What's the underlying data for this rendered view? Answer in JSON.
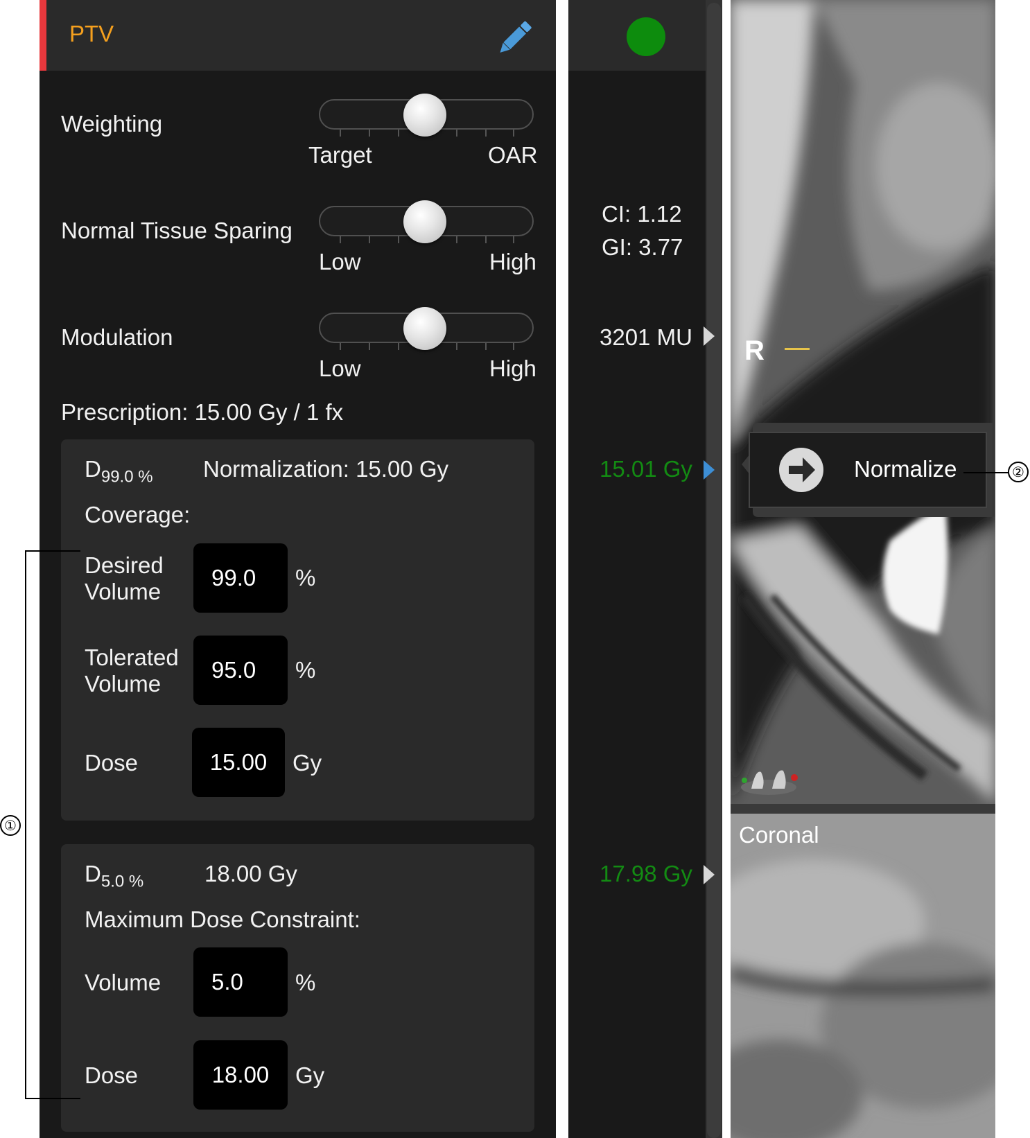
{
  "header": {
    "structure_name": "PTV",
    "edit_icon": "pencil-icon"
  },
  "sliders": [
    {
      "label": "Weighting",
      "min_label": "Target",
      "max_label": "OAR",
      "level": 0.5
    },
    {
      "label": "Normal Tissue Sparing",
      "min_label": "Low",
      "max_label": "High",
      "level": 0.5
    },
    {
      "label": "Modulation",
      "min_label": "Low",
      "max_label": "High",
      "level": 0.5
    }
  ],
  "prescription": "Prescription: 15.00 Gy / 1 fx",
  "coverage_box": {
    "metric_main": "D",
    "metric_sub": "99.0 %",
    "normalization": "Normalization: 15.00 Gy",
    "title": "Coverage:",
    "fields": [
      {
        "label_1": "Desired",
        "label_2": "Volume",
        "value": "99.0",
        "unit": "%"
      },
      {
        "label_1": "Tolerated",
        "label_2": "Volume",
        "value": "95.0",
        "unit": "%"
      },
      {
        "label_1": "Dose",
        "label_2": "",
        "value": "15.00",
        "unit": "Gy"
      }
    ]
  },
  "max_dose_box": {
    "metric_main": "D",
    "metric_sub": "5.0 %",
    "value": "18.00 Gy",
    "title": "Maximum Dose Constraint:",
    "fields": [
      {
        "label": "Volume",
        "value": "5.0",
        "unit": "%"
      },
      {
        "label": "Dose",
        "value": "18.00",
        "unit": "Gy"
      }
    ]
  },
  "metrics": {
    "ci": "CI:  1.12",
    "gi": "GI:  3.77",
    "mu": "3201 MU",
    "coverage_result": "15.01 Gy",
    "max_dose_result": "17.98 Gy"
  },
  "status": {
    "color": "#0d8c0d"
  },
  "image_view": {
    "orientation_label": "R",
    "lower_view_label": "Coronal",
    "normalize_button": "Normalize",
    "normalize_icon": "arrow-right-circle-icon"
  },
  "annotations": {
    "callout_1": "①",
    "callout_2": "②"
  },
  "colors": {
    "accent_red": "#e8383d",
    "structure_orange": "#f5a01e",
    "result_green": "#138b13",
    "active_arrow_blue": "#3d8fd6"
  }
}
